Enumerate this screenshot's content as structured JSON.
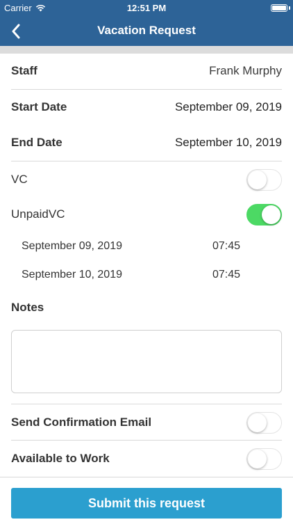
{
  "status_bar": {
    "carrier": "Carrier",
    "time": "12:51 PM"
  },
  "nav": {
    "title": "Vacation Request",
    "back_icon": "chevron-left-icon"
  },
  "form": {
    "staff_label": "Staff",
    "staff_value": "Frank Murphy",
    "start_date_label": "Start Date",
    "start_date_value": "September 09, 2019",
    "end_date_label": "End Date",
    "end_date_value": "September 10, 2019",
    "vc_label": "VC",
    "vc_on": false,
    "unpaid_label": "UnpaidVC",
    "unpaid_on": true,
    "entries": [
      {
        "date": "September 09, 2019",
        "time": "07:45"
      },
      {
        "date": "September 10, 2019",
        "time": "07:45"
      }
    ],
    "notes_label": "Notes",
    "notes_value": "",
    "send_email_label": "Send Confirmation Email",
    "send_email_on": false,
    "available_label": "Available to Work",
    "available_on": false
  },
  "submit_label": "Submit this request",
  "colors": {
    "bar": "#2d6397",
    "toggle_on": "#4cd964",
    "submit": "#2b9fcf"
  }
}
